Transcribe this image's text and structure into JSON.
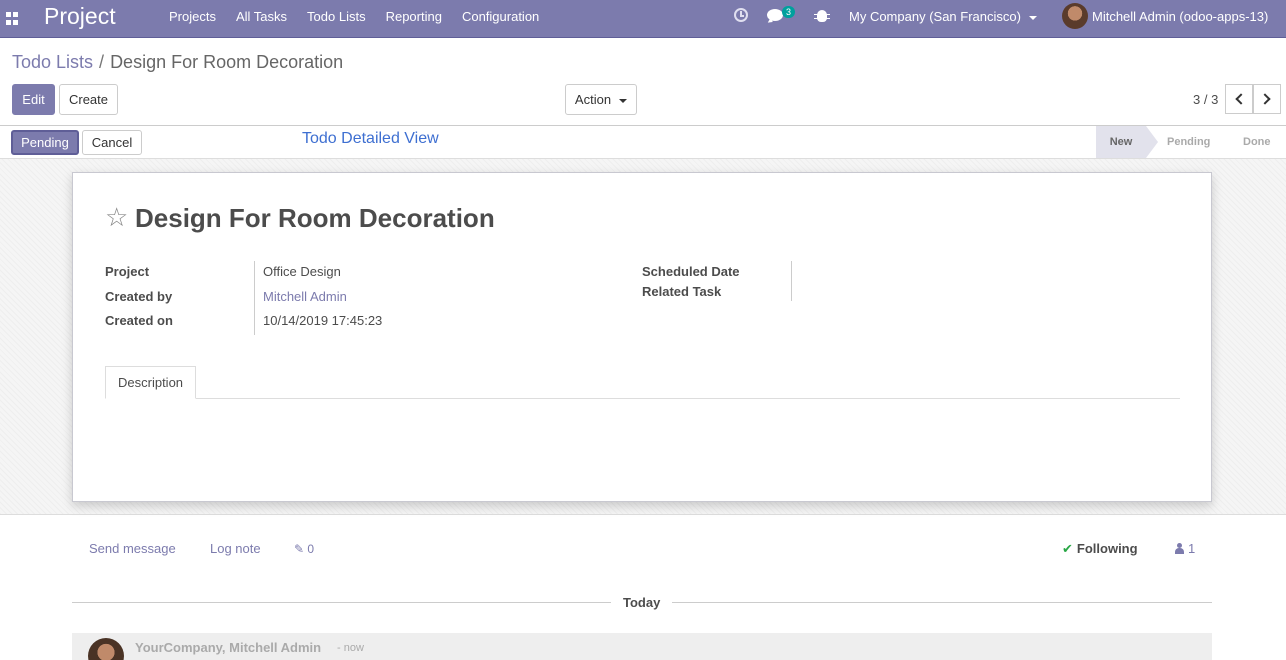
{
  "navbar": {
    "brand": "Project",
    "menu": [
      "Projects",
      "All Tasks",
      "Todo Lists",
      "Reporting",
      "Configuration"
    ],
    "chat_badge": "3",
    "company": "My Company (San Francisco)",
    "user": "Mitchell Admin (odoo-apps-13)",
    "icons": [
      "apps-icon",
      "clock-icon",
      "chat-icon",
      "bug-icon",
      "avatar"
    ]
  },
  "breadcrumb": {
    "parent": "Todo Lists",
    "separator": "/",
    "current": "Design For Room Decoration"
  },
  "control": {
    "edit": "Edit",
    "create": "Create",
    "action": "Action",
    "pager": "3 / 3"
  },
  "status": {
    "pending_button": "Pending",
    "cancel_button": "Cancel",
    "annotation": "Todo Detailed View",
    "stages": [
      "New",
      "Pending",
      "Done"
    ],
    "active_stage": "New"
  },
  "record": {
    "title": "Design For Room Decoration",
    "fields_left": [
      {
        "label": "Project",
        "value": "Office Design"
      },
      {
        "label": "Created by",
        "value": "Mitchell Admin"
      },
      {
        "label": "Created on",
        "value": "10/14/2019 17:45:23"
      }
    ],
    "fields_right": [
      {
        "label": "Scheduled Date",
        "value": ""
      },
      {
        "label": "Related Task",
        "value": ""
      }
    ],
    "tab": "Description"
  },
  "chatter": {
    "send_message": "Send message",
    "log_note": "Log note",
    "attachments": "0",
    "following": "Following",
    "followers": "1",
    "date_separator": "Today",
    "message_author": "YourCompany, Mitchell Admin",
    "message_time": "- now"
  },
  "colors": {
    "brand": "#7c7bad",
    "annotation": "#3e6fd1",
    "following_check": "#28a745"
  }
}
